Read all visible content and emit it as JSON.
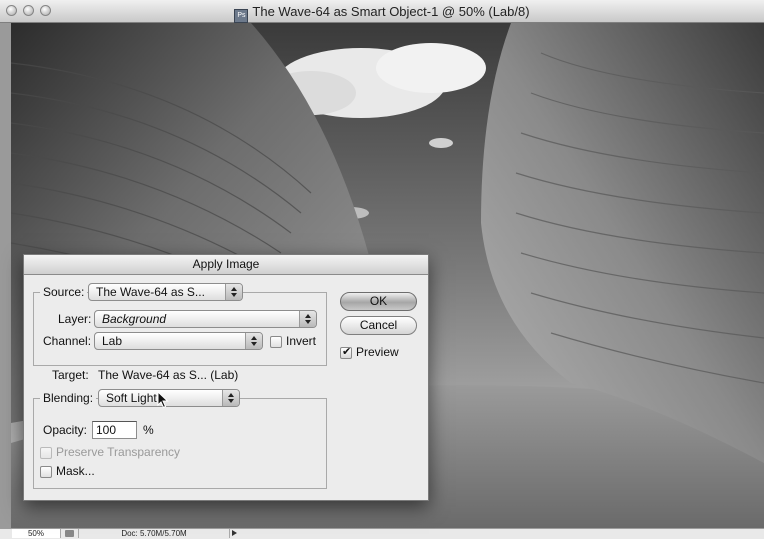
{
  "window": {
    "title": "The Wave-64 as Smart Object-1 @ 50% (Lab/8)",
    "app_icon_label": "Ps"
  },
  "status_bar": {
    "zoom": "50%",
    "doc_size": "Doc: 5.70M/5.70M"
  },
  "dialog": {
    "title": "Apply Image",
    "source_label": "Source:",
    "source_value": "The Wave-64 as S...",
    "layer_label": "Layer:",
    "layer_value": "Background",
    "channel_label": "Channel:",
    "channel_value": "Lab",
    "invert_label": "Invert",
    "invert_checked": false,
    "target_label": "Target:",
    "target_value": "The Wave-64 as S... (Lab)",
    "blending_label": "Blending:",
    "blending_value": "Soft Light",
    "opacity_label": "Opacity:",
    "opacity_value": "100",
    "opacity_unit": "%",
    "preserve_transparency_label": "Preserve Transparency",
    "preserve_transparency_enabled": false,
    "mask_label": "Mask...",
    "mask_checked": false,
    "ok_label": "OK",
    "cancel_label": "Cancel",
    "preview_label": "Preview",
    "preview_checked": true
  }
}
